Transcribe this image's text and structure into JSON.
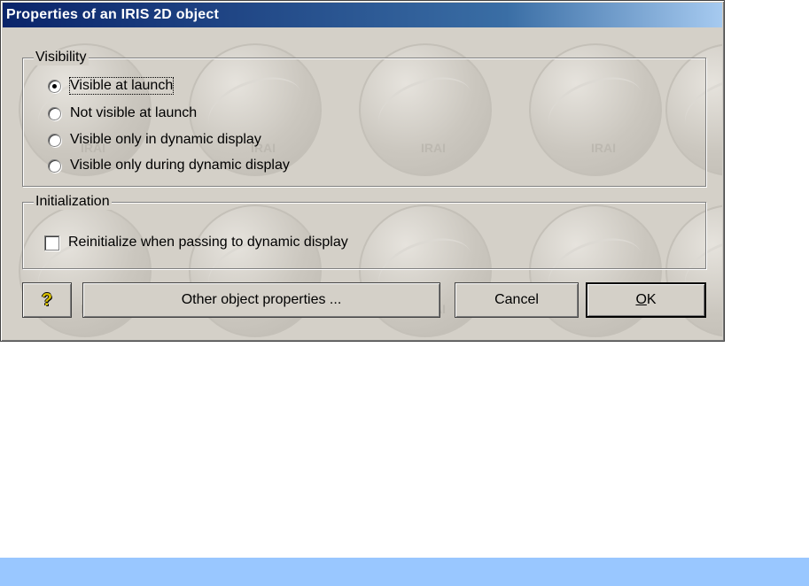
{
  "window": {
    "title": "Properties of an IRIS 2D object"
  },
  "visibility": {
    "legend": "Visibility",
    "options": [
      {
        "label": "Visible at launch",
        "checked": true
      },
      {
        "label": "Not visible at launch",
        "checked": false
      },
      {
        "label": "Visible only in dynamic display",
        "checked": false
      },
      {
        "label": "Visible only during dynamic display",
        "checked": false
      }
    ]
  },
  "initialization": {
    "legend": "Initialization",
    "checkbox_label": "Reinitialize when passing to dynamic display",
    "checked": false
  },
  "buttons": {
    "help_icon": "?",
    "other_label": "Other object properties ...",
    "cancel_label": "Cancel",
    "ok_label": "OK"
  },
  "colors": {
    "title_bar": "#0a246a",
    "dialog_bg": "#d4d0c8",
    "bottom_bar": "#99c7ff"
  }
}
